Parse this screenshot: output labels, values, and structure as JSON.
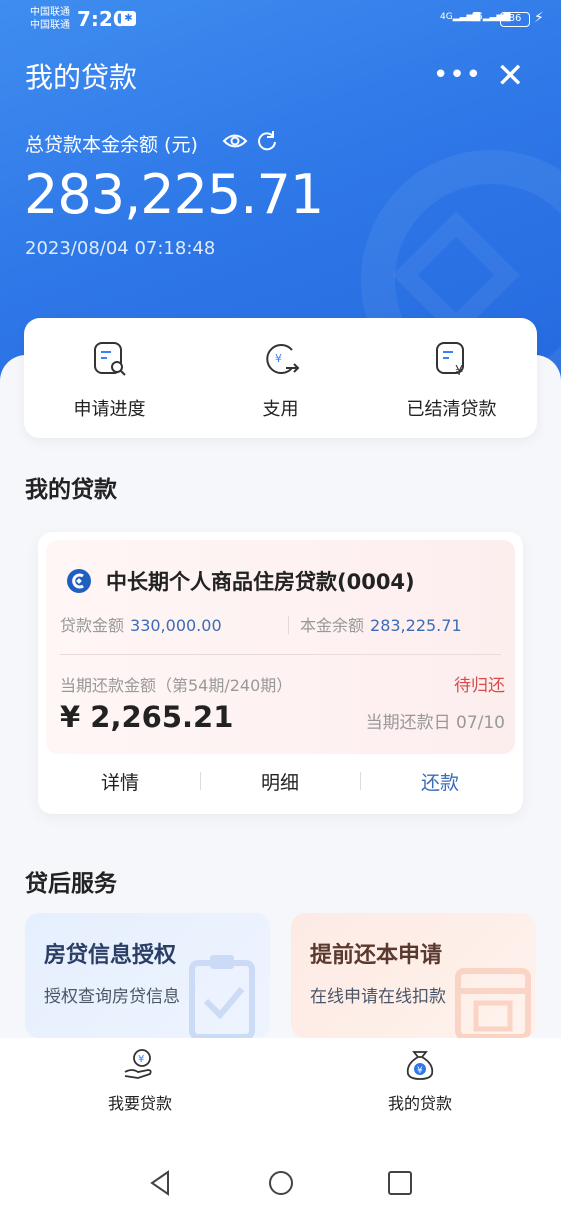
{
  "status_bar": {
    "carrier_1": "中国联通",
    "carrier_2": "中国联通",
    "time": "7:20",
    "signal_1": "4G",
    "signal_2": "4G",
    "battery": "86"
  },
  "header": {
    "title": "我的贷款",
    "more_icon": "more-icon",
    "close_icon": "close-icon"
  },
  "balance": {
    "label": "总贷款本金余额 (元)",
    "amount": "283,225.71",
    "timestamp": "2023/08/04 07:18:48"
  },
  "quick_actions": [
    {
      "label": "申请进度",
      "icon": "application-progress-icon"
    },
    {
      "label": "支用",
      "icon": "disburse-icon"
    },
    {
      "label": "已结清贷款",
      "icon": "settled-loans-icon"
    }
  ],
  "my_loans": {
    "section_title": "我的贷款",
    "loan": {
      "name": "中长期个人商品住房贷款(0004)",
      "loan_amount_label": "贷款金额",
      "loan_amount": "330,000.00",
      "principal_balance_label": "本金余额",
      "principal_balance": "283,225.71",
      "period_label": "当期还款金额（第54期/240期）",
      "status": "待归还",
      "payment_amount": "¥ 2,265.21",
      "due_date": "当期还款日 07/10"
    },
    "actions": {
      "details": "详情",
      "breakdown": "明细",
      "repay": "还款"
    }
  },
  "post_loan_services": {
    "section_title": "贷后服务",
    "cards": [
      {
        "title": "房贷信息授权",
        "subtitle": "授权查询房贷信息"
      },
      {
        "title": "提前还本申请",
        "subtitle": "在线申请在线扣款"
      }
    ]
  },
  "tab_bar": [
    {
      "label": "我要贷款",
      "icon": "apply-loan-icon"
    },
    {
      "label": "我的贷款",
      "icon": "my-loan-icon"
    }
  ],
  "colors": {
    "brand_blue": "#2f78e8",
    "accent_blue": "#3b6cb8",
    "status_red": "#d84b4b"
  }
}
